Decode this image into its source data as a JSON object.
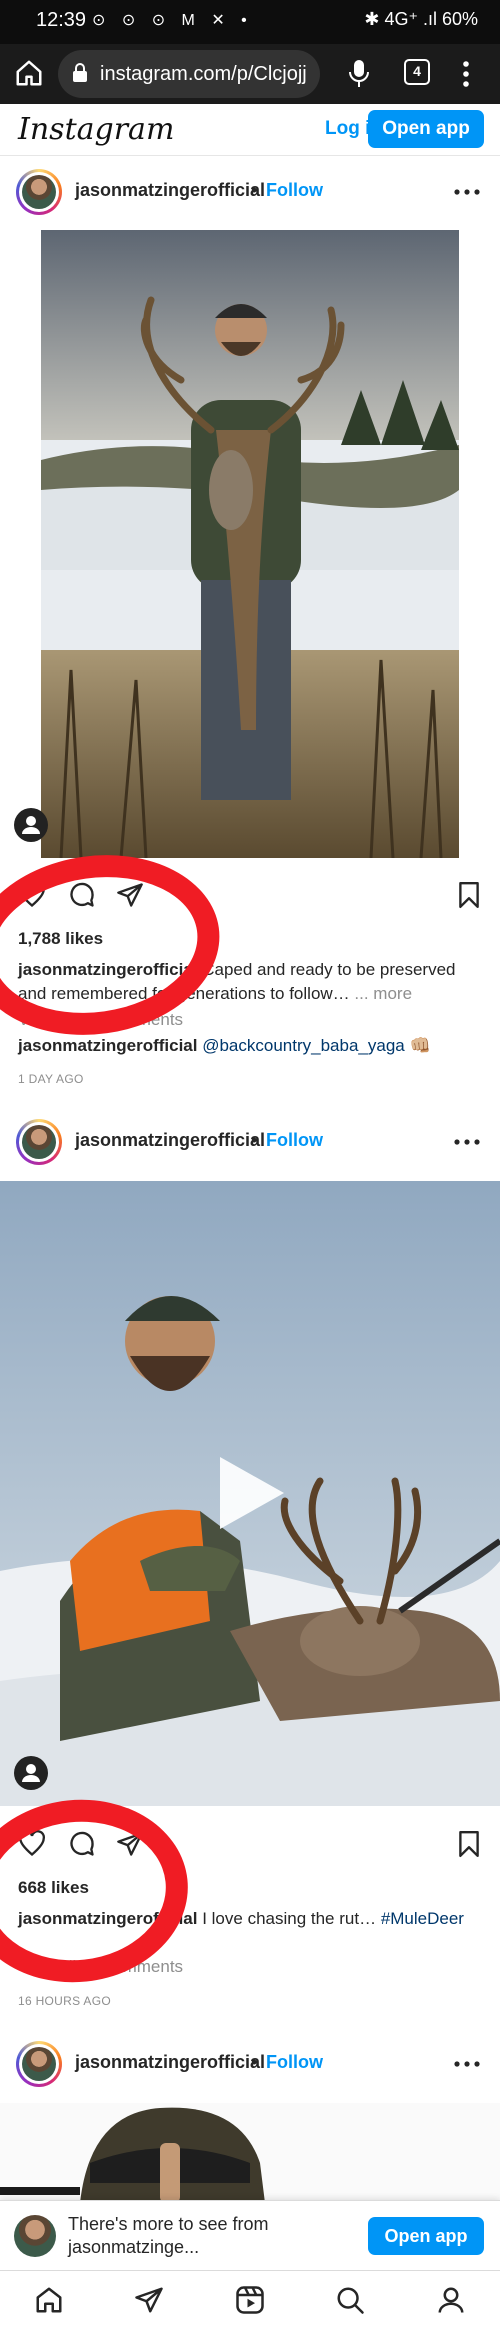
{
  "status_bar": {
    "time": "12:39",
    "notification_icons": "⊙ ⊙ ⊙ M ✕ •",
    "right": "✱ 4G⁺ .ıl 60%"
  },
  "browser": {
    "url": "instagram.com/p/Clcjojj",
    "tab_count": "4"
  },
  "ig_header": {
    "logo": "Instagram",
    "login_label": "Log in",
    "open_app_label": "Open app"
  },
  "posts": [
    {
      "username": "jasonmatzingerofficial",
      "separator": "•",
      "follow_label": "Follow",
      "likes": "1,788 likes",
      "caption_user": "jasonmatzingerofficial",
      "caption_text": " Caped and ready to be preserved and remembered for generations to follow… ",
      "caption_more": "... more",
      "view_comments": "View all 35 comments",
      "comment_user": "jasonmatzingerofficial",
      "comment_mention": "@backcountry_baba_yaga",
      "comment_emoji": "👊🏼",
      "time_ago": "1 DAY AGO"
    },
    {
      "username": "jasonmatzingerofficial",
      "separator": "•",
      "follow_label": "Follow",
      "likes": "668 likes",
      "caption_user": "jasonmatzingerofficial",
      "caption_text": " I love chasing the rut… ",
      "caption_hashtag": "#MuleDeer",
      "view_comments": "View all 21 comments",
      "time_ago": "16 HOURS AGO"
    },
    {
      "username": "jasonmatzingerofficial",
      "separator": "•",
      "follow_label": "Follow"
    }
  ],
  "more_banner": {
    "text": "There's more to see from jasonmatzinge...",
    "button_label": "Open app"
  },
  "colors": {
    "accent": "#0095f6",
    "annotation_red": "#f01c24",
    "status_bar_bg": "#0d0d0d",
    "browser_bar_bg": "#1b1b1b"
  },
  "icons": {
    "home": "home-icon",
    "lock": "lock-icon",
    "mic": "mic-icon",
    "kebab": "kebab-menu-icon",
    "more": "more-horizontal-icon",
    "heart": "heart-icon",
    "comment": "comment-icon",
    "share": "share-icon",
    "bookmark": "bookmark-icon",
    "play": "play-icon",
    "person": "tagged-person-icon",
    "explore": "search-icon",
    "reels": "reels-icon",
    "profile": "profile-icon"
  }
}
